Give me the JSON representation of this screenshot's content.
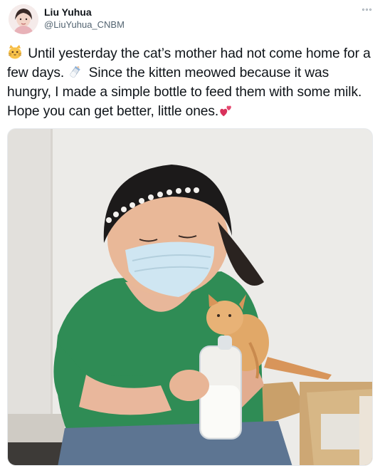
{
  "author": {
    "name": "Liu Yuhua",
    "handle": "@LiuYuhua_CNBM"
  },
  "tweet": {
    "text_part1": "Until yesterday the cat’s mother had not come home for a few days.",
    "text_part2": "Since the kitten meowed because it was hungry, I made a simple bottle to feed them with some milk. Hope you can get better, little ones.",
    "emoji_start": "cat-face-icon",
    "emoji_middle": "baby-bottle-icon",
    "emoji_end": "two-hearts-icon"
  },
  "media": {
    "subject": "woman-feeding-kitten-photo"
  },
  "colors": {
    "text": "#0f1419",
    "secondary": "#536471",
    "shirt": "#2f8c55",
    "mask": "#cfe6f2",
    "kitten": "#e1a868"
  }
}
